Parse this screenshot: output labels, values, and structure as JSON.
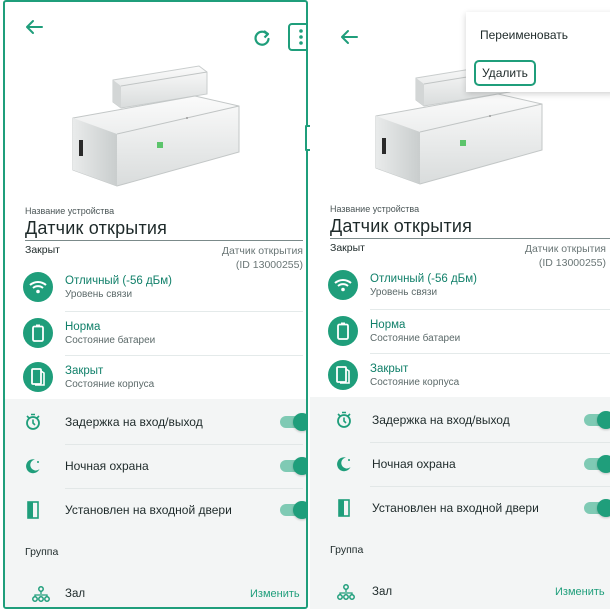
{
  "screen": {
    "device_name_label": "Название устройства",
    "device_name_value": "Датчик открытия",
    "closed_short": "Закрыт",
    "device_type_line1": "Датчик открытия",
    "device_type_line2": "(ID 13000255)",
    "status": [
      {
        "icon": "wifi-icon",
        "main": "Отличный (-56 дБм)",
        "sub": "Уровень связи"
      },
      {
        "icon": "battery-icon",
        "main": "Норма",
        "sub": "Состояние батареи"
      },
      {
        "icon": "case-icon",
        "main": "Закрыт",
        "sub": "Состояние корпуса"
      }
    ],
    "toggles": [
      {
        "icon": "delay-timer-icon",
        "label": "Задержка на вход/выход",
        "on": true
      },
      {
        "icon": "moon-icon",
        "label": "Ночная охрана",
        "on": true
      },
      {
        "icon": "door-icon",
        "label": "Установлен на входной двери",
        "on": true
      }
    ],
    "group_label": "Группа",
    "group_name": "Зал",
    "change_label": "Изменить"
  },
  "menu": {
    "rename_label": "Переименовать",
    "delete_label": "Удалить"
  },
  "colors": {
    "accent": "#1f9e7b",
    "accent_dark": "#11806a",
    "toggle_track": "#7fcab4",
    "band": "#f3f5f5"
  }
}
